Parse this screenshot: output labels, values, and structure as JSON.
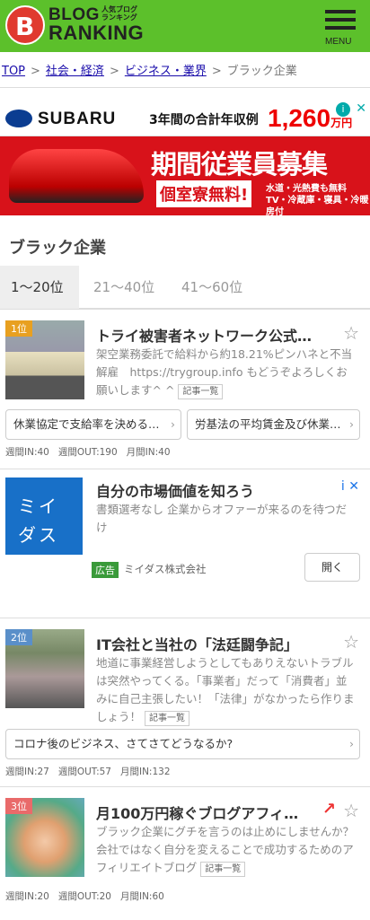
{
  "header": {
    "logo_letter": "B",
    "logo_line1": "BLOG",
    "logo_line2": "RANKING",
    "logo_small1": "人気ブログ",
    "logo_small2": "ランキング",
    "menu_label": "MENU"
  },
  "breadcrumb": {
    "items": [
      "TOP",
      "社会・経済",
      "ビジネス・業界"
    ],
    "current": "ブラック企業"
  },
  "ad_banner": {
    "brand": "SUBARU",
    "tagline": "3年間の合計年収例",
    "amount": "1,260",
    "amount_unit": "万円",
    "headline": "期間従業員募集",
    "sub": "個室寮無料!",
    "sub2_line1": "水道・光熱費も無料",
    "sub2_line2": "TV・冷蔵庫・寝具・冷暖房付"
  },
  "category": {
    "title": "ブラック企業",
    "tabs": [
      {
        "label": "1〜20位",
        "active": true
      },
      {
        "label": "21〜40位",
        "active": false
      },
      {
        "label": "41〜60位",
        "active": false
      }
    ]
  },
  "entries": [
    {
      "rank": "1位",
      "title": "トライ被害者ネットワーク公式…",
      "desc": "架空業務委託で給料から約18.21%ピンハネと不当解雇　https://trygroup.info もどうぞよろしくお願いします^ ^",
      "tag": "記事一覧",
      "related": [
        "休業協定で支給率を決める…",
        "労基法の平均賃金及び休業…"
      ],
      "stats": {
        "in_week": "週間IN:40",
        "out_week": "週間OUT:190",
        "in_month": "月間IN:40"
      }
    },
    {
      "rank": "2位",
      "title": "IT会社と当社の「法廷闘争記」",
      "desc": "地道に事業経営しようとしてもありえないトラブルは突然やってくる。「事業者」だって「消費者」並みに自己主張したい！「法律」がなかったら作りましょう！",
      "tag": "記事一覧",
      "related": [
        "コロナ後のビジネス、さてさてどうなるか?"
      ],
      "stats": {
        "in_week": "週間IN:27",
        "out_week": "週間OUT:57",
        "in_month": "月間IN:132"
      }
    },
    {
      "rank": "3位",
      "title": "月100万円稼ぐブログアフィ…",
      "desc": "ブラック企業にグチを言うのは止めにしませんか？会社ではなく自分を変えることで成功するためのアフィリエイトブログ",
      "tag": "記事一覧",
      "stats": {
        "in_week": "週間IN:20",
        "out_week": "週間OUT:20",
        "in_month": "月間IN:60"
      }
    }
  ],
  "native_ad": {
    "logo_line1": "ミイ",
    "logo_line2": "ダス",
    "title": "自分の市場価値を知ろう",
    "desc": "書類選考なし 企業からオファーが来るのを待つだけ",
    "label": "広告",
    "company": "ミイダス株式会社",
    "button": "開く"
  },
  "icons": {
    "star": "☆",
    "chevron": "›",
    "close": "✕",
    "info": "i",
    "arrow_up": "↗"
  }
}
